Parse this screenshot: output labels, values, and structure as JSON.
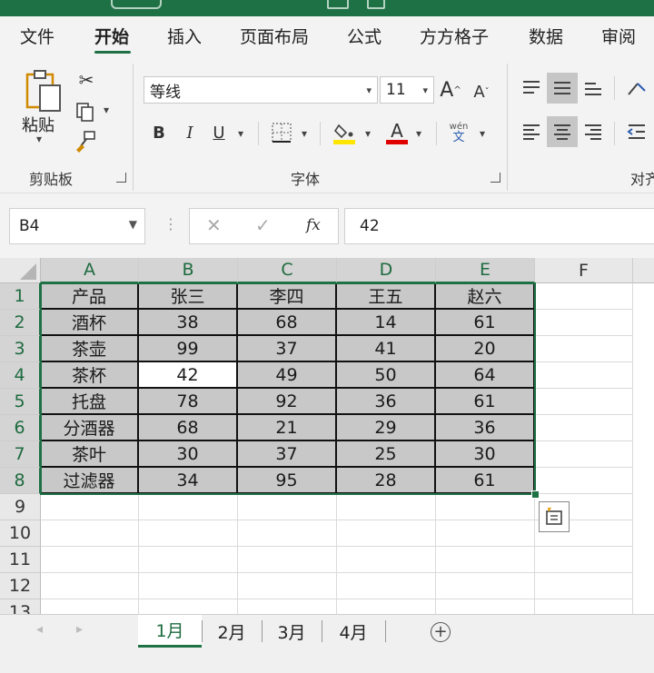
{
  "ribbon_tabs": [
    "文件",
    "开始",
    "插入",
    "页面布局",
    "公式",
    "方方格子",
    "数据",
    "审阅"
  ],
  "active_tab": "开始",
  "clipboard": {
    "paste_label": "粘贴",
    "group_label": "剪贴板"
  },
  "font": {
    "name": "等线",
    "size": "11",
    "group_label": "字体",
    "pinyin_top": "wén",
    "pinyin_bottom": "文",
    "bold": "B",
    "italic": "I",
    "underline": "U",
    "grow": "A",
    "shrink": "A"
  },
  "alignment": {
    "group_label": "对齐"
  },
  "formula_bar": {
    "name_box": "B4",
    "fx_label": "fx",
    "value": "42"
  },
  "columns": [
    "A",
    "B",
    "C",
    "D",
    "E",
    "F"
  ],
  "rows": [
    "1",
    "2",
    "3",
    "4",
    "5",
    "6",
    "7",
    "8",
    "9",
    "10",
    "11",
    "12",
    "13"
  ],
  "table": {
    "headers": [
      "产品",
      "张三",
      "李四",
      "王五",
      "赵六"
    ],
    "rows": [
      [
        "酒杯",
        "38",
        "68",
        "14",
        "61"
      ],
      [
        "茶壶",
        "99",
        "37",
        "41",
        "20"
      ],
      [
        "茶杯",
        "42",
        "49",
        "50",
        "64"
      ],
      [
        "托盘",
        "78",
        "92",
        "36",
        "61"
      ],
      [
        "分酒器",
        "68",
        "21",
        "29",
        "36"
      ],
      [
        "茶叶",
        "30",
        "37",
        "25",
        "30"
      ],
      [
        "过滤器",
        "34",
        "95",
        "28",
        "61"
      ]
    ]
  },
  "active_cell": "B4",
  "sheets": [
    "1月",
    "2月",
    "3月",
    "4月"
  ],
  "active_sheet": "1月",
  "colors": {
    "accent": "#1e7145",
    "highlight": "#ffe600",
    "font_color": "#e00000"
  }
}
